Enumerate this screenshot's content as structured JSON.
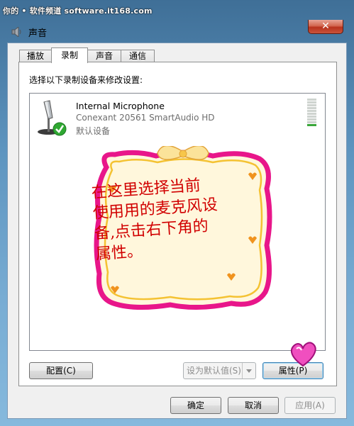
{
  "watermark": "你的 • 软件频道 software.it168.com",
  "window": {
    "title": "声音",
    "close_label": "✕"
  },
  "tabs": [
    {
      "label": "播放",
      "active": false
    },
    {
      "label": "录制",
      "active": true
    },
    {
      "label": "声音",
      "active": false
    },
    {
      "label": "通信",
      "active": false
    }
  ],
  "instruction": "选择以下录制设备来修改设置:",
  "device": {
    "name": "Internal Microphone",
    "driver": "Conexant 20561 SmartAudio HD",
    "status": "默认设备",
    "level": 0.1
  },
  "annotation": {
    "lines": [
      "在这里选择当前",
      "使用用的麦克风设",
      "备,点击右下角的",
      "属性。"
    ]
  },
  "buttons": {
    "configure": "配置(C)",
    "set_default": "设为默认值(S)",
    "properties": "属性(P)",
    "ok": "确定",
    "cancel": "取消",
    "apply": "应用(A)"
  },
  "colors": {
    "annotation_text": "#d10000",
    "note_border": "#e8168a",
    "default_check": "#2fa832"
  }
}
